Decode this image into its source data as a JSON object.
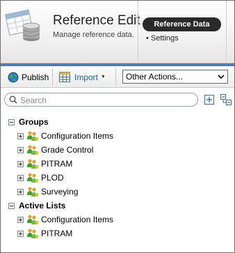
{
  "header": {
    "title": "Reference Edit",
    "subtitle": "Manage reference data.",
    "nav_active": "Reference Data",
    "nav_items": [
      {
        "label": "• Settings"
      }
    ]
  },
  "toolbar": {
    "publish_label": "Publish",
    "import_label": "Import",
    "actions_selected": "Other Actions..."
  },
  "search": {
    "placeholder": "Search"
  },
  "tree": {
    "groups": [
      {
        "label": "Groups",
        "items": [
          {
            "label": "Configuration Items"
          },
          {
            "label": "Grade Control"
          },
          {
            "label": "PITRAM"
          },
          {
            "label": "PLOD"
          },
          {
            "label": "Surveying"
          }
        ]
      },
      {
        "label": "Active Lists",
        "items": [
          {
            "label": "Configuration Items"
          },
          {
            "label": "PITRAM"
          }
        ]
      }
    ]
  },
  "colors": {
    "accent_bar": "#4b7fb0",
    "nav_active_bg": "#2a2a2a",
    "import_text": "#1f5fa8"
  },
  "icons": {
    "app": "database-table-icon",
    "publish": "globe-icon",
    "import": "spreadsheet-icon",
    "tree_node": "people-group-icon",
    "expand_all": "expand-all-icon",
    "collapse_all": "collapse-all-icon"
  }
}
